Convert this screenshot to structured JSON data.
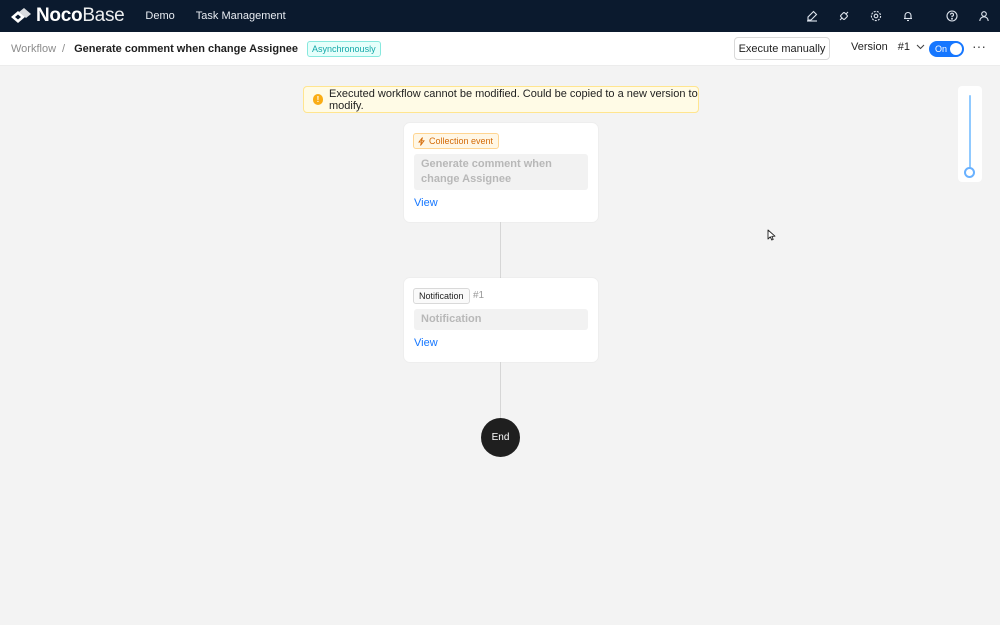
{
  "app": {
    "logo_bold": "Noco",
    "logo_light": "Base",
    "nav": [
      "Demo",
      "Task Management"
    ],
    "icons": [
      "highlighter-icon",
      "plugin-icon",
      "settings-icon",
      "bell-icon",
      "help-icon",
      "user-icon"
    ]
  },
  "header": {
    "breadcrumb_root": "Workflow",
    "breadcrumb_separator": "/",
    "title": "Generate comment when change Assignee",
    "mode_tag": "Asynchronously",
    "execute_button": "Execute manually",
    "version_label": "Version",
    "version_number": "#1",
    "toggle_label": "On",
    "toggle_on": true,
    "more_label": "···"
  },
  "alert": {
    "text": "Executed workflow cannot be modified. Could be copied to a new version to modify."
  },
  "trigger": {
    "type_label": "Collection event",
    "title": "Generate comment when change Assignee",
    "view_label": "View"
  },
  "nodes": [
    {
      "type_label": "Notification",
      "index": "#1",
      "title": "Notification",
      "view_label": "View"
    }
  ],
  "end_label": "End",
  "zoom": {
    "level": 1.0
  },
  "colors": {
    "topbar": "#0b1a2e",
    "accent": "#1677ff",
    "warning": "#faad14",
    "async_tag": "#13a8a8",
    "trigger_tag": "#d46b08"
  }
}
